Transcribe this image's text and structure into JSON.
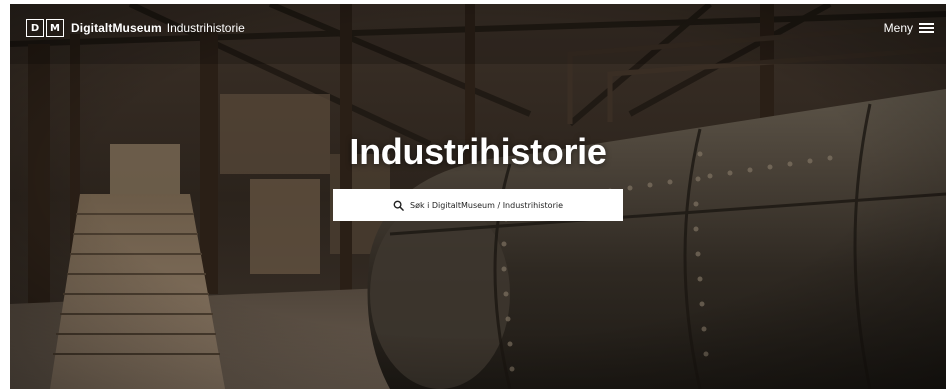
{
  "header": {
    "logo_letters": [
      "D",
      "M"
    ],
    "brand_name": "DigitaltMuseum",
    "section_name": "Industrihistorie",
    "menu_label": "Meny"
  },
  "hero": {
    "title": "Industrihistorie",
    "search_placeholder": "Søk i DigitaltMuseum / Industrihistorie"
  },
  "colors": {
    "overlay_text": "#ffffff",
    "search_bg": "#ffffff",
    "search_text": "#222222"
  },
  "icons": {
    "menu": "hamburger-icon",
    "search": "search-icon"
  }
}
